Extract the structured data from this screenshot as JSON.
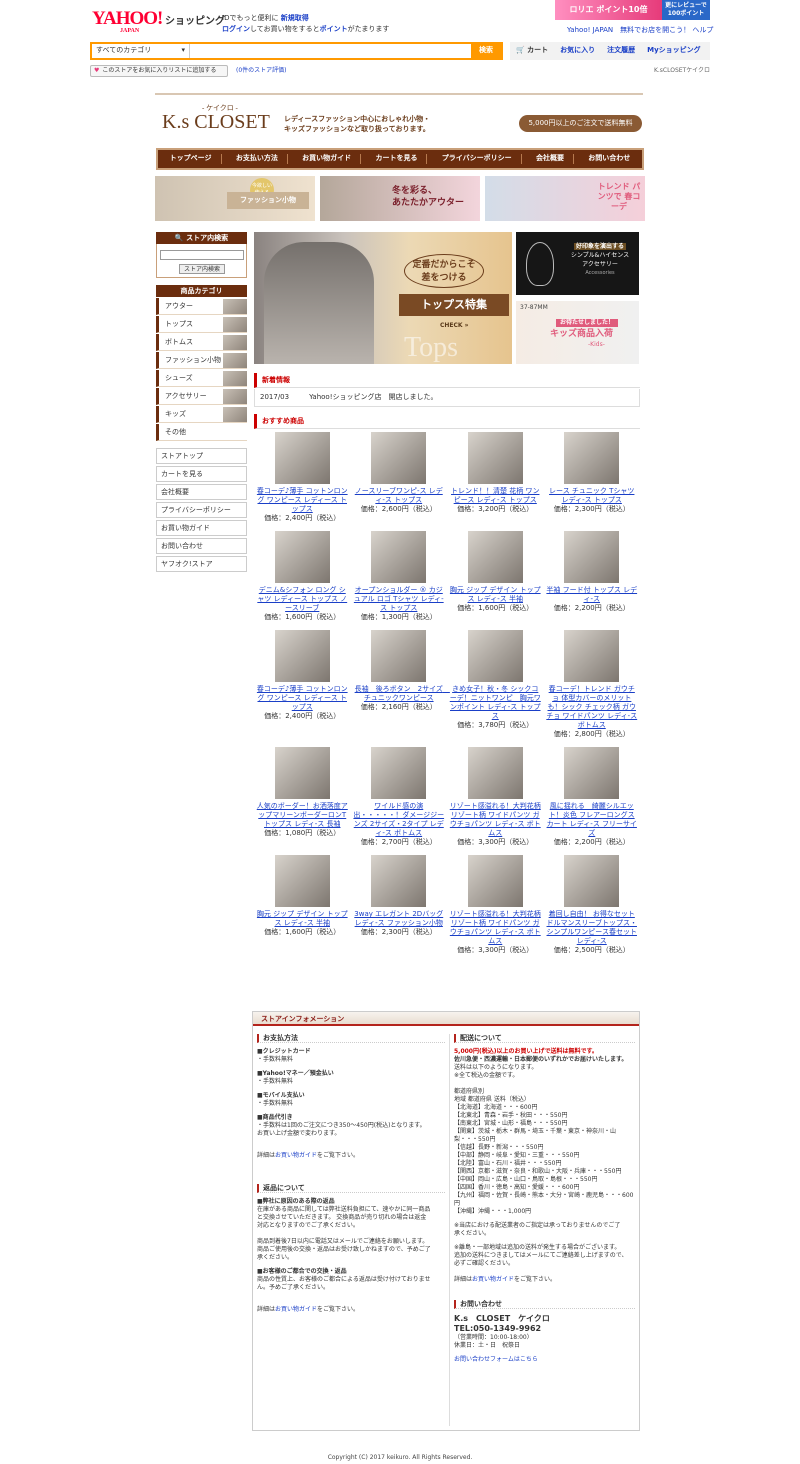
{
  "yahoo": {
    "logo": "YAHOO!",
    "logo_sub": "JAPAN",
    "shopping": "ショッピング",
    "msg1_pre": "IDでもっと便利に",
    "msg1_link": "新規取得",
    "msg2_link": "ログイン",
    "msg2_mid": "してお買い物をすると",
    "msg2_link2": "ポイント",
    "msg2_post": "がたまります",
    "banner_main": "ロリエ ポイント10倍",
    "banner_side": "更にレビューで100ポイント",
    "review_link": "Yahoo! JAPAN　無料でお店を開こう！",
    "help_link": "ヘルプ",
    "search_category": "すべてのカテゴリ",
    "search_placeholder": "",
    "search_button": "検索",
    "nav": [
      "カート",
      "お気に入り",
      "注文履歴",
      "Myショッピング"
    ],
    "fav_button": "このストアをお気に入りリストに追加する",
    "review_count": "(0件のストア評価)",
    "store_name_right": "K.sCLOSETケイクロ"
  },
  "store": {
    "kana": "- ケイクロ -",
    "name": "K.s CLOSET",
    "tagline1": "レディースファッション中心におしゃれ小物・",
    "tagline2": "キッズファッションなど取り扱っております。",
    "free_shipping": "5,000円以上のご注文で送料無料",
    "gnav": [
      "トップページ",
      "お支払い方法",
      "お買い物ガイド",
      "カートを見る",
      "プライバシーポリシー",
      "会社概要",
      "お問い合わせ"
    ],
    "promo1_tag": "今欲しい 使える",
    "promo1_text": "ファッション小物",
    "promo2_text1": "冬を彩る、",
    "promo2_text2": "あたたかアウター",
    "promo3_text": "トレンド パンツで 春コーデ"
  },
  "sidebar": {
    "search_title": "ストア内検索",
    "search_button": "ストア内検索",
    "category_title": "商品カテゴリ",
    "categories": [
      "アウター",
      "トップス",
      "ボトムス",
      "ファッション小物",
      "シューズ",
      "アクセサリー",
      "キッズ",
      "その他"
    ],
    "links": [
      "ストアトップ",
      "カートを見る",
      "会社概要",
      "プライバシーポリシー",
      "お買い物ガイド",
      "お問い合わせ",
      "ヤフオク!ストア"
    ]
  },
  "hero": {
    "text1": "定番だからこそ",
    "text2": "差をつける",
    "title": "トップス特集",
    "check": "CHECK",
    "bg": "Tops"
  },
  "side1": {
    "l1": "好印象を演出する",
    "l2": "シンプル&ハイセンス",
    "l3": "アクセサリー",
    "l4": "Accessories"
  },
  "side2": {
    "top": "37-87MM",
    "l1": "お待たせしました！",
    "l2": "キッズ商品入荷",
    "l3": "-Kids-"
  },
  "news": {
    "title": "新着情報",
    "date": "2017/03",
    "text": "Yahoo!ショッピング店　開店しました。"
  },
  "recommended": {
    "title": "おすすめ商品",
    "items": [
      {
        "name": "春コーデ♪薄手 コットンロング ワンピース レディース トップス",
        "price": "価格：2,400円（税込）"
      },
      {
        "name": "ノースリーブワンピ-ス レディ-ス トップス",
        "price": "価格：2,600円（税込）"
      },
      {
        "name": "トレンド！！清楚 花柄 ワンピース レディ-ス トップス",
        "price": "価格：3,200円（税込）"
      },
      {
        "name": "レース チュニック Tシャツ レディ-ス トップス",
        "price": "価格：2,300円（税込）"
      },
      {
        "name": "デニム&シフォン ロング シャツ レディース トップス ノースリーブ",
        "price": "価格：1,600円（税込）"
      },
      {
        "name": "オープンショルダー ® カジュアル ロゴ Tシャツ レディ-ス トップス",
        "price": "価格：1,300円（税込）"
      },
      {
        "name": "胸元 ジップ デザイン トップス レディ-ス 半袖",
        "price": "価格：1,600円（税込）"
      },
      {
        "name": "半袖 フード付 トップス レディ-ス",
        "price": "価格：2,200円（税込）"
      },
      {
        "name": "春コーデ♪薄手 コットンロング ワンピース レディース トップス",
        "price": "価格：2,400円（税込）"
      },
      {
        "name": "長袖　後ろボタン　2サイズ　チュニックワンピース",
        "price": "価格：2,160円（税込）"
      },
      {
        "name": "きめ女子！秋・冬 シックコーデ！ニットワンピ　胸元ワンポイント レディ-ス トップス",
        "price": "価格：3,780円（税込）"
      },
      {
        "name": "春コーデ！トレンド ガウチョ 体型カバーのメリットも！シック チェック柄 ガウチョ ワイドパンツ レディ-ス ボトムス",
        "price": "価格：2,800円（税込）"
      },
      {
        "name": "人気のボーダー！お洒落度アップマリーンボーダーロンT トップス レディ-ス 長袖",
        "price": "価格：1,080円（税込）"
      },
      {
        "name": "ワイルド感の演出・・・・・！ダメージジーンズ 2サイズ・2タイプ レディ-ス ボトムス",
        "price": "価格：2,700円（税込）"
      },
      {
        "name": "リゾート感溢れる！大判花柄リゾート柄 ワイドパンツ ガウチョパンツ レディ-ス ボトムス",
        "price": "価格：3,300円（税込）"
      },
      {
        "name": "風に揺れる　綺麗シルエット！炎色 フレアーロングスカート レディ-ス フリーサイズ",
        "price": "価格：2,200円（税込）"
      },
      {
        "name": "胸元 ジップ デザイン トップス レディ-ス 半袖",
        "price": "価格：1,600円（税込）"
      },
      {
        "name": "3way エレガント 2Dバッグ レディ-ス ファッション小物",
        "price": "価格：2,300円（税込）"
      },
      {
        "name": "リゾート感溢れる！大判花柄リゾート柄 ワイドパンツ ガウチョパンツ レディ-ス ボトムス",
        "price": "価格：3,300円（税込）"
      },
      {
        "name": "着回し自由！ お得なセット ドルマンスリーブトップス・シンプルワンピース春セット レディ-ス",
        "price": "価格：2,500円（税込）"
      }
    ]
  },
  "info": {
    "title": "ストアインフォメーション",
    "pay_title": "お支払方法",
    "pay_credit": "■クレジットカード",
    "pay_credit_fee": "・手数料無料",
    "pay_yahoo": "■Yahoo!マネー／預金払い",
    "pay_yahoo_fee": "・手数料無料",
    "pay_mobile": "■モバイル支払い",
    "pay_mobile_fee": "・手数料無料",
    "pay_cod": "■商品代引き",
    "pay_cod_fee": "・手数料は1回のご注文につき350〜450円(税込)となります。",
    "pay_cod_note": "お買い上げ金額で変わります。",
    "detail_pre": "詳細は",
    "detail_link": "お買い物ガイド",
    "detail_post": "をご覧下さい。",
    "return_title": "返品について",
    "ret1_h": "■弊社に原因のある際の返品",
    "ret1_b1": "在庫がある商品に関しては弊社送料負担にて、速やかに同一商品",
    "ret1_b2": "と交換させていただきます。 交換商品が売り切れの場合は返金",
    "ret1_b3": "対応となりますのでご了承ください。",
    "ret2_b1": "商品到着後7日以内に電話又はメールでご連絡をお願いします。",
    "ret2_b2": "商品ご使用後の交換・返品はお受け致しかねますので、予めご了",
    "ret2_b3": "承ください。",
    "ret3_h": "■お客様のご都合での交換・返品",
    "ret3_b1": "商品の性質上、お客様のご都合による返品は受け付けておりませ",
    "ret3_b2": "ん。予めご了承ください。",
    "ship_title": "配送について",
    "ship_free": "5,000円(税込)以上のお買い上げで送料は無料です。",
    "ship_l1": "佐川急便・西濃運輸・日本郵便のいずれかでお届けいたします。",
    "ship_l2": "送料は以下のようになります。",
    "ship_l3": "※全て税込の金額です。",
    "ship_l4": "都道府県別",
    "ship_l5": "地域 都道府県 送料（税込）",
    "ship_rates": [
      "【北海道】北海道・・・600円",
      "【北東北】青森・岩手・秋田・・・550円",
      "【南東北】宮城・山形・福島・・・550円",
      "【関東】茨城・栃木・群馬・埼玉・千葉・東京・神奈川・山梨・・・550円",
      "【信越】長野・新潟・・・550円",
      "【中部】静岡・岐阜・愛知・三重・・・550円",
      "【北陸】富山・石川・福井・・・550円",
      "【関西】京都・滋賀・奈良・和歌山・大阪・兵庫・・・550円",
      "【中国】岡山・広島・山口・鳥取・島根・・・550円",
      "【四国】香川・徳島・高知・愛媛・・・600円",
      "【九州】福岡・佐賀・長崎・熊本・大分・宮崎・鹿児島・・・600円",
      "【沖縄】沖縄・・・1,000円"
    ],
    "ship_n1": "※当店における配送業者のご指定は承っておりませんのでご了",
    "ship_n1b": "承ください。",
    "ship_n2": "※離島・一部地域は追加の送料が発生する場合がございます。",
    "ship_n3": "追加の送料につきましてはメールにてご連絡差し上げますので、",
    "ship_n4": "必ずご確認ください。",
    "contact_title": "お問い合わせ",
    "contact_name": "K.s　CLOSET　ケイクロ",
    "contact_tel": "TEL:050-1349-9962",
    "contact_hours": "（営業時間：10:00-18:00）",
    "contact_holiday": "休業日：土・日　祝祭日",
    "contact_form": "お問い合わせフォームはこちら"
  },
  "footer": "Copyright (C) 2017 keikuro. All Rights Reserved."
}
